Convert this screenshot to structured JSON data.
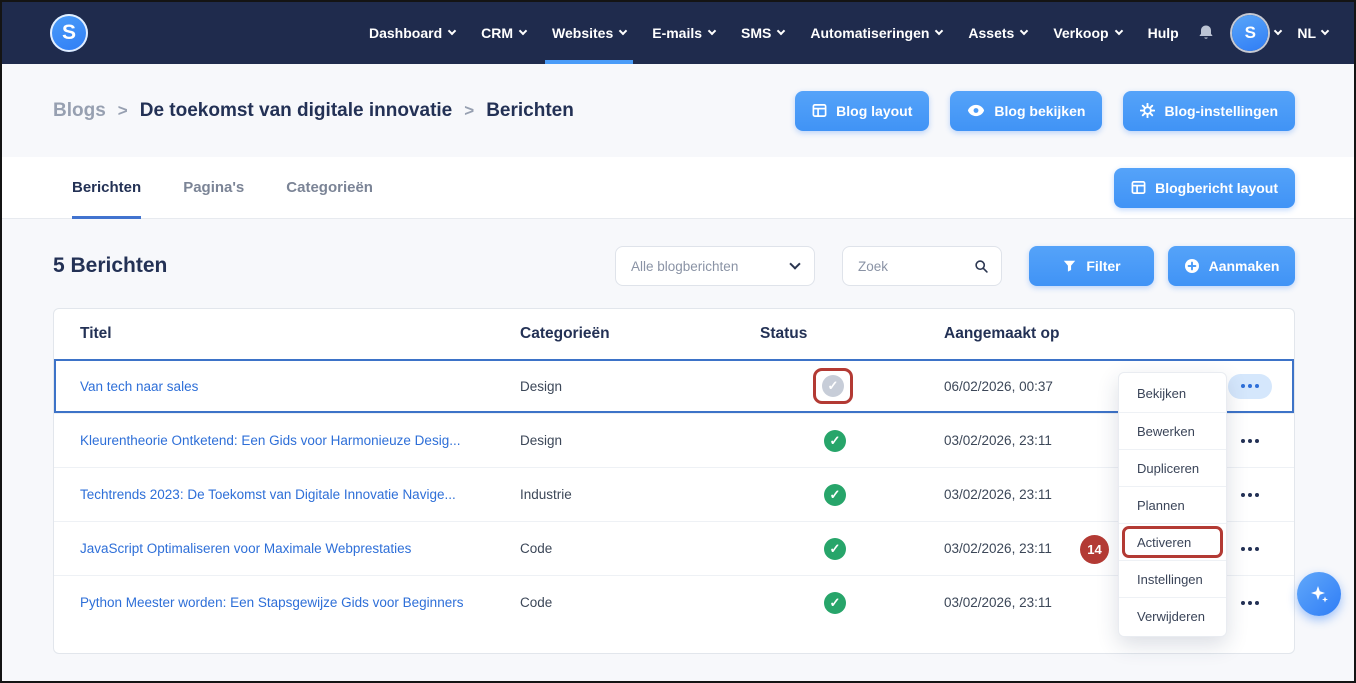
{
  "navbar": {
    "logo_letter": "S",
    "items": [
      {
        "label": "Dashboard"
      },
      {
        "label": "CRM"
      },
      {
        "label": "Websites"
      },
      {
        "label": "E-mails"
      },
      {
        "label": "SMS"
      },
      {
        "label": "Automatiseringen"
      },
      {
        "label": "Assets"
      },
      {
        "label": "Verkoop"
      },
      {
        "label": "Hulp"
      }
    ],
    "active_item": "Websites",
    "avatar_letter": "S",
    "language": "NL"
  },
  "breadcrumb": {
    "items": [
      "Blogs",
      "De toekomst van digitale innovatie",
      "Berichten"
    ],
    "separator": ">"
  },
  "header_actions": [
    {
      "label": "Blog layout",
      "icon": "layout-icon"
    },
    {
      "label": "Blog bekijken",
      "icon": "eye-icon"
    },
    {
      "label": "Blog-instellingen",
      "icon": "gear-icon"
    }
  ],
  "tabs": [
    {
      "label": "Berichten",
      "active": true
    },
    {
      "label": "Pagina's",
      "active": false
    },
    {
      "label": "Categorieën",
      "active": false
    }
  ],
  "tabbar_button": "Blogbericht layout",
  "content": {
    "title": "5 Berichten",
    "filter_select_value": "Alle blogberichten",
    "search_placeholder": "Zoek",
    "filter_button": "Filter",
    "create_button": "Aanmaken"
  },
  "table": {
    "headers": [
      "Titel",
      "Categorieën",
      "Status",
      "Aangemaakt op"
    ],
    "rows": [
      {
        "title": "Van tech naar sales",
        "category": "Design",
        "status": "inactive",
        "created": "06/02/2026, 00:37",
        "selected": true
      },
      {
        "title": "Kleurentheorie Ontketend: Een Gids voor Harmonieuze Desig...",
        "category": "Design",
        "status": "active",
        "created": "03/02/2026, 23:11",
        "selected": false
      },
      {
        "title": "Techtrends 2023: De Toekomst van Digitale Innovatie Navige...",
        "category": "Industrie",
        "status": "active",
        "created": "03/02/2026, 23:11",
        "selected": false
      },
      {
        "title": "JavaScript Optimaliseren voor Maximale Webprestaties",
        "category": "Code",
        "status": "active",
        "created": "03/02/2026, 23:11",
        "selected": false
      },
      {
        "title": "Python Meester worden: Een Stapsgewijze Gids voor Beginners",
        "category": "Code",
        "status": "active",
        "created": "03/02/2026, 23:11",
        "selected": false
      }
    ]
  },
  "context_menu": {
    "items": [
      "Bekijken",
      "Bewerken",
      "Dupliceren",
      "Plannen",
      "Activeren",
      "Instellingen",
      "Verwijderen"
    ],
    "highlighted_item": "Activeren"
  },
  "annotations": {
    "step_badge": "14"
  },
  "colors": {
    "navbar_bg": "#1f2b4d",
    "accent_blue": "#4a9cf8",
    "link_blue": "#2e6fd8",
    "success_green": "#27a56a",
    "inactive_gray": "#c7cdd8",
    "annotation_red": "#b33a34",
    "selected_row_border": "#3d73c8",
    "page_bg": "#f7f8fb"
  }
}
